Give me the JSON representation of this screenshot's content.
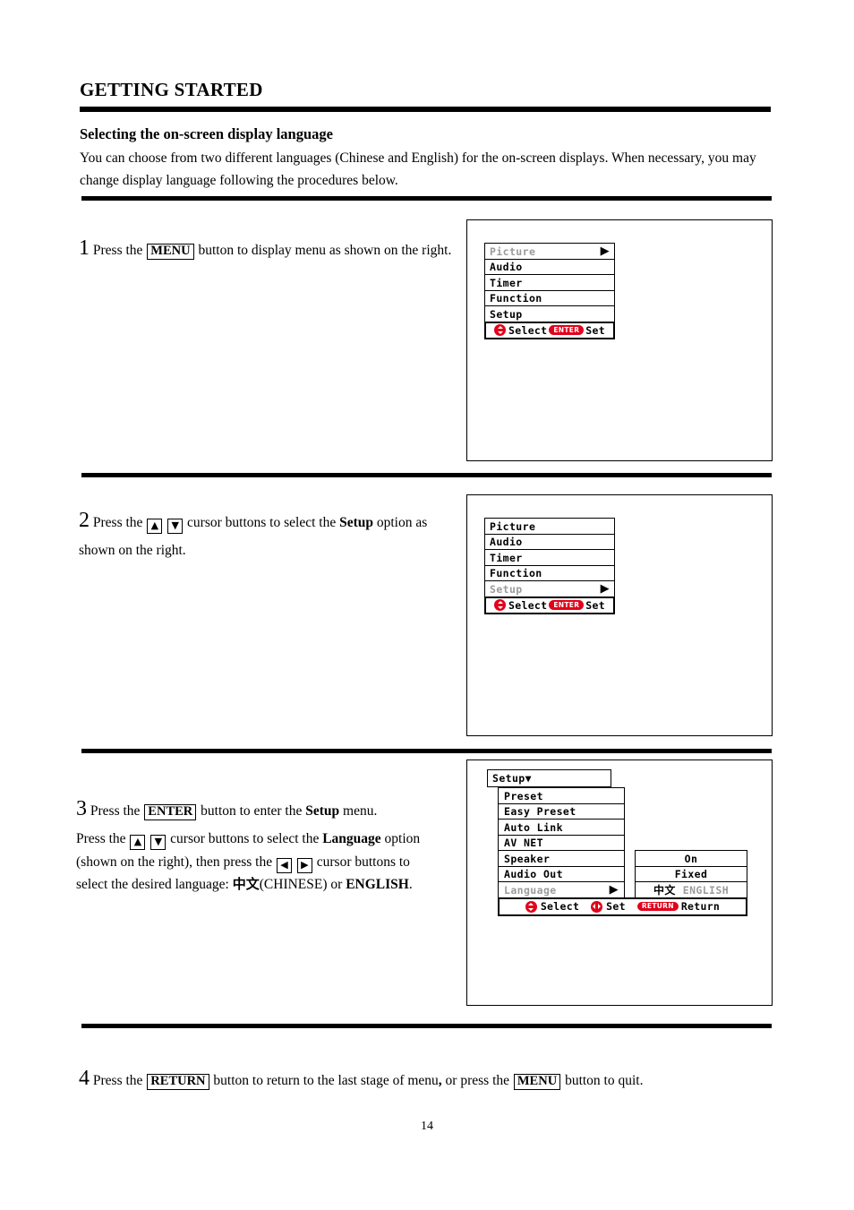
{
  "document": {
    "chapter_title": "GETTING STARTED",
    "section_heading": "Selecting the on-screen display language",
    "intro_paragraph": "You can choose from two different languages (Chinese and English) for the on-screen displays. When necessary, you may change display language following the procedures below.",
    "page_number": "14"
  },
  "steps": {
    "step1": {
      "number": "1",
      "text_a": "Press the",
      "key_menu": "MENU",
      "text_b": "button to display menu as shown on the right."
    },
    "step2": {
      "number": "2",
      "text_a": "Press the",
      "key_up": "▲",
      "key_down": "▼",
      "text_b": "cursor buttons to select the",
      "bold_setup": "Setup",
      "text_c": "option as shown on the right."
    },
    "step3": {
      "number": "3",
      "line1_a": "Press the",
      "key_enter": "ENTER",
      "line1_b": "button to enter the",
      "line1_bold": "Setup",
      "line1_c": "menu.",
      "line2_a": "Press the",
      "key_up": "▲",
      "key_down": "▼",
      "line2_b": "cursor buttons to select the",
      "line2_bold": "Language",
      "line2_c": "option",
      "line3_a": "(shown on the right), then press the",
      "key_left": "◀",
      "key_right": "▶",
      "line3_b": "cursor buttons to",
      "line4_a": "select the desired language:",
      "lang_chinese": "中文",
      "line4_b": "(CHINESE) or",
      "lang_english": "ENGLISH",
      "line4_c": "."
    },
    "step4": {
      "number": "4",
      "text_a": "Press the",
      "key_return": "RETURN",
      "text_b": "button to return to the last stage of menu",
      "comma": ",",
      "text_c": "or press the",
      "key_menu": "MENU",
      "text_d": "button to quit."
    }
  },
  "osd": {
    "main_menu_items": [
      "Picture",
      "Audio",
      "Timer",
      "Function",
      "Setup"
    ],
    "screen1": {
      "highlighted_item": "Picture",
      "items": [
        {
          "label": "Picture",
          "dim": true,
          "arrow": "▶"
        },
        {
          "label": "Audio",
          "dim": false,
          "arrow": ""
        },
        {
          "label": "Timer",
          "dim": false,
          "arrow": ""
        },
        {
          "label": "Function",
          "dim": false,
          "arrow": ""
        },
        {
          "label": "Setup",
          "dim": false,
          "arrow": ""
        }
      ],
      "hint_select": "Select",
      "hint_enter_badge": "ENTER",
      "hint_set": "Set"
    },
    "screen2": {
      "highlighted_item": "Setup",
      "items": [
        {
          "label": "Picture",
          "dim": false,
          "arrow": ""
        },
        {
          "label": "Audio",
          "dim": false,
          "arrow": ""
        },
        {
          "label": "Timer",
          "dim": false,
          "arrow": ""
        },
        {
          "label": "Function",
          "dim": false,
          "arrow": ""
        },
        {
          "label": "Setup",
          "dim": true,
          "arrow": "▶"
        }
      ],
      "hint_select": "Select",
      "hint_enter_badge": "ENTER",
      "hint_set": "Set"
    },
    "screen3": {
      "title": "Setup",
      "title_arrow": "▼",
      "rows": [
        {
          "label": "Preset",
          "dim": false,
          "arrow": "",
          "value": null,
          "value2": null
        },
        {
          "label": "Easy Preset",
          "dim": false,
          "arrow": "",
          "value": null,
          "value2": null
        },
        {
          "label": "Auto Link",
          "dim": false,
          "arrow": "",
          "value": null,
          "value2": null
        },
        {
          "label": "AV NET",
          "dim": false,
          "arrow": "",
          "value": null,
          "value2": null
        },
        {
          "label": "Speaker",
          "dim": false,
          "arrow": "",
          "value": "On",
          "value2": null
        },
        {
          "label": "Audio Out",
          "dim": false,
          "arrow": "",
          "value": "Fixed",
          "value2": null
        },
        {
          "label": "Language",
          "dim": true,
          "arrow": "▶",
          "value": "中文",
          "value2": "ENGLISH"
        }
      ],
      "hint_select": "Select",
      "hint_set": "Set",
      "hint_return": "Return",
      "hint_return_badge": "RETURN"
    }
  },
  "colors": {
    "accent_red": "#e2001a",
    "dim_grey": "#9b9b9b",
    "ink": "#000000",
    "paper": "#ffffff"
  }
}
